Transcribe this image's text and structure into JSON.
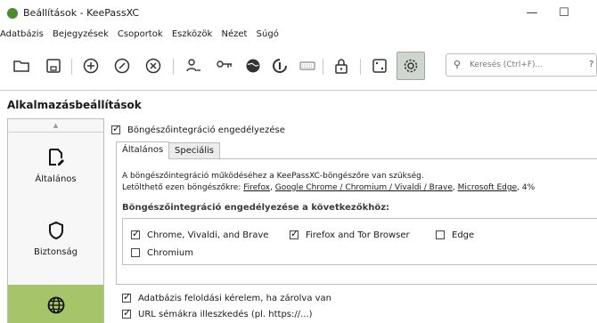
{
  "window": {
    "title": "Beállítások - KeePassXC",
    "minimize": "—",
    "maximize": "☐",
    "close": "✕"
  },
  "menu": [
    "Adatbázis",
    "Bejegyzések",
    "Csoportok",
    "Eszközök",
    "Nézet",
    "Súgó"
  ],
  "toolbar": {
    "icons": [
      "open-database-icon",
      "save-database-icon",
      "add-entry-icon",
      "edit-entry-icon",
      "delete-entry-icon",
      "transfer-user-icon",
      "key-icon",
      "globe-download-icon",
      "keyboard-icon",
      "lock-icon",
      "dice-icon",
      "settings-icon"
    ],
    "search_placeholder": "Keresés (Ctrl+F)...",
    "search_help": "?"
  },
  "page": {
    "heading": "Alkalmazásbeállítások"
  },
  "sidebar": {
    "scroll_up": "▲",
    "items": [
      {
        "label": "Általános",
        "icon": "edit-document-icon"
      },
      {
        "label": "Biztonság",
        "icon": "shield-icon"
      },
      {
        "label": "",
        "icon": "globe-icon"
      }
    ]
  },
  "browser": {
    "enable_label": "Böngészőintegráció engedélyezése",
    "enable_checked": true,
    "tabs": [
      {
        "label": "Általános",
        "active": true
      },
      {
        "label": "Speciális",
        "active": false
      }
    ],
    "info_line1": "A böngészőintegráció működéséhez a KeePassXC-böngészőre van szükség.",
    "info_line2_prefix": "Letölthető ezen böngészőkre:",
    "links": [
      "Firefox",
      "Google Chrome / Chromium / Vivaldi / Brave",
      "Microsoft Edge"
    ],
    "info_suffix": ", 4%",
    "group_title": "Böngészőintegráció engedélyezése a következőkhöz:",
    "targets": [
      {
        "label": "Chrome, Vivaldi, and Brave",
        "checked": true
      },
      {
        "label": "Firefox and Tor Browser",
        "checked": true
      },
      {
        "label": "Edge",
        "checked": false
      },
      {
        "label": "Chromium",
        "checked": false
      }
    ],
    "options": [
      {
        "label": "Adatbázis feloldási kérelem, ha zárolva van",
        "checked": true
      },
      {
        "label": "URL sémákra illeszkedés (pl. https://...)",
        "checked": true
      }
    ]
  },
  "colors": {
    "accent": "#a6c46a",
    "app_icon": "#4a8b2e"
  }
}
